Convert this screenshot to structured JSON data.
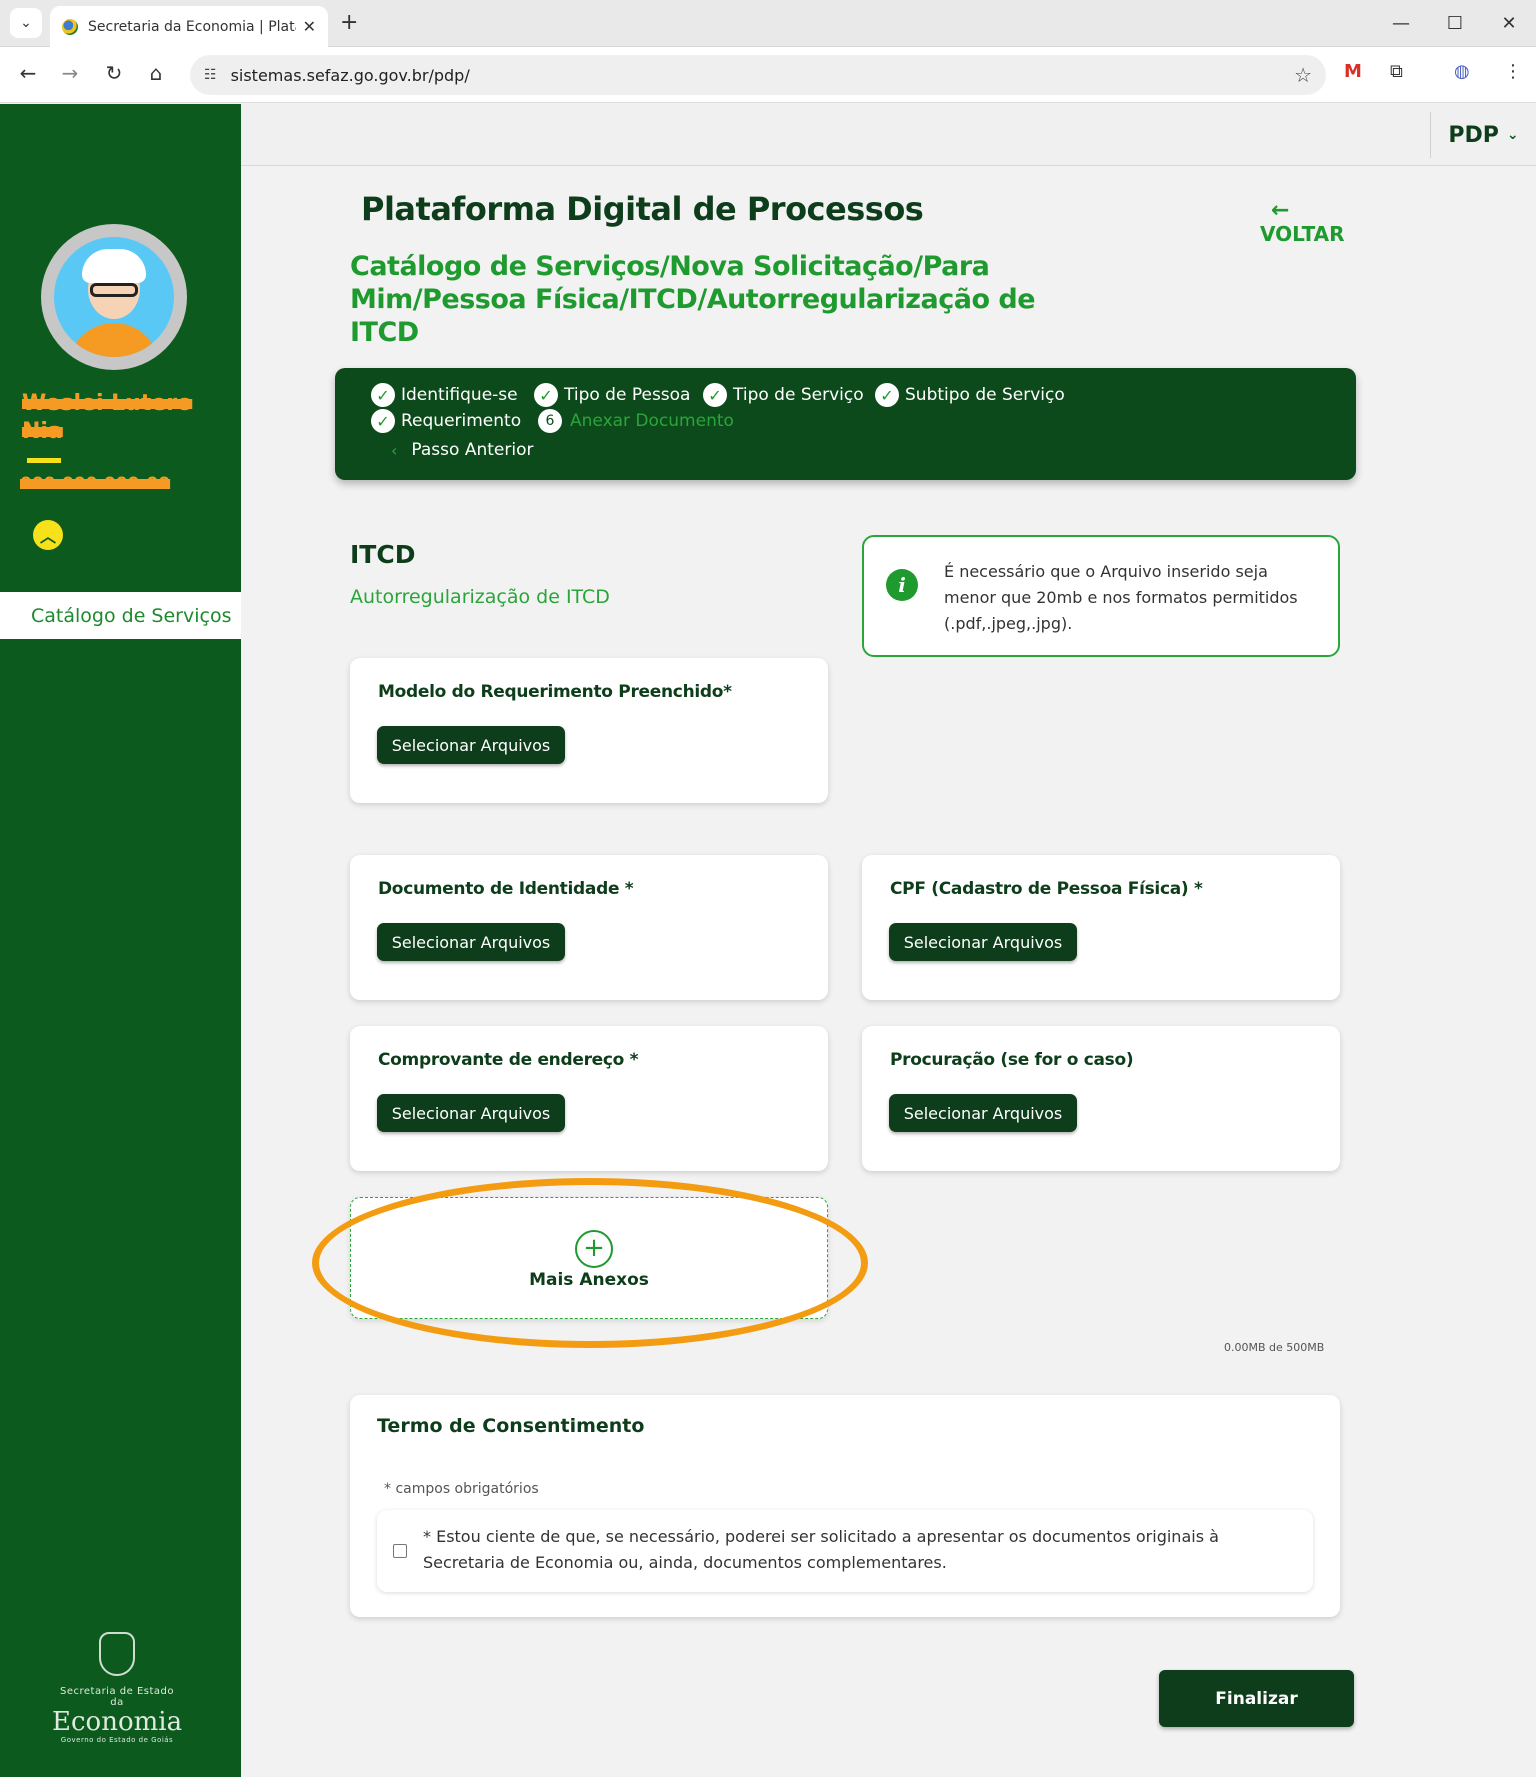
{
  "browser": {
    "tab_title": "Secretaria da Economia | Plataforma Digital de Processos",
    "url": "sistemas.sefaz.go.gov.br/pdp/"
  },
  "sidebar": {
    "user_name": "Weslei Lutero Nia",
    "user_doc": "000.000.000-00",
    "menu_item": "Catálogo de Serviços",
    "logo": {
      "line1": "Secretaria de Estado da",
      "line2": "Economia",
      "line3": "Governo do Estado de Goiás"
    }
  },
  "header": {
    "app_menu": "PDP"
  },
  "page": {
    "title": "Plataforma Digital de Processos",
    "breadcrumb": "Catálogo de Serviços/Nova Solicitação/Para Mim/Pessoa Física/ITCD/Autorregularização de ITCD",
    "back_label": "VOLTAR"
  },
  "stepper": {
    "steps": [
      {
        "label": "Identifique-se",
        "done": true
      },
      {
        "label": "Tipo de Pessoa",
        "done": true
      },
      {
        "label": "Tipo de Serviço",
        "done": true
      },
      {
        "label": "Subtipo de Serviço",
        "done": true
      },
      {
        "label": "Requerimento",
        "done": true
      },
      {
        "label": "Anexar Documento",
        "number": "6",
        "active": true
      }
    ],
    "prev_label": "Passo Anterior"
  },
  "section": {
    "title": "ITCD",
    "subtitle": "Autorregularização de ITCD",
    "info": "É necessário que o Arquivo inserido seja menor que 20mb e nos formatos permitidos (.pdf,.jpeg,.jpg)."
  },
  "uploads": [
    {
      "label": "Modelo do Requerimento Preenchido*",
      "button": "Selecionar Arquivos"
    },
    {
      "label": "Documento de Identidade *",
      "button": "Selecionar Arquivos"
    },
    {
      "label": "CPF (Cadastro de Pessoa Física) *",
      "button": "Selecionar Arquivos"
    },
    {
      "label": "Comprovante de endereço *",
      "button": "Selecionar Arquivos"
    },
    {
      "label": "Procuração (se for o caso)",
      "button": "Selecionar Arquivos"
    }
  ],
  "more_attachments": "Mais Anexos",
  "quota": "0.00MB de 500MB",
  "consent": {
    "title": "Termo de Consentimento",
    "required_note": "* campos obrigatórios",
    "text": "* Estou ciente de que, se necessário, poderei ser solicitado a apresentar os documentos originais à Secretaria de Economia ou, ainda, documentos complementares.",
    "checked": false
  },
  "submit_label": "Finalizar",
  "colors": {
    "sidebar_green": "#0d5a1e",
    "dark_green": "#0d3d1a",
    "accent_green": "#1e9a2e",
    "highlight_orange": "#f39c12"
  }
}
